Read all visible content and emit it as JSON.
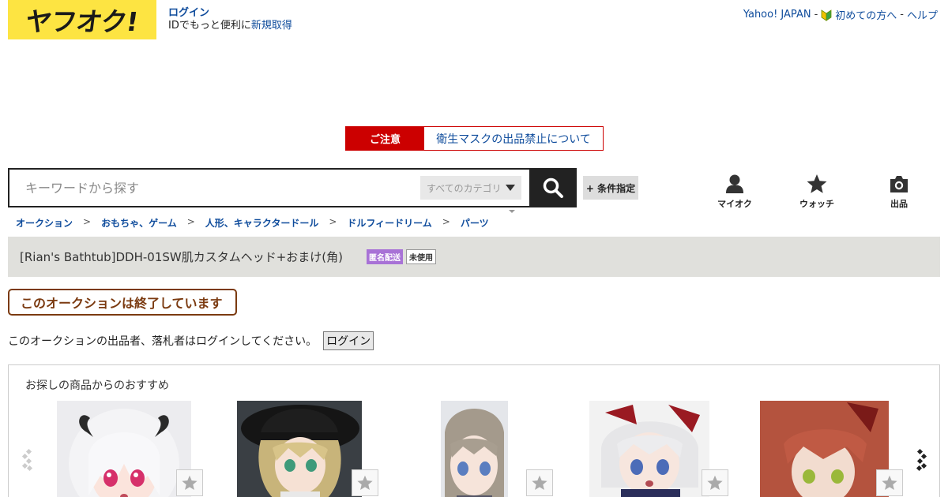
{
  "header": {
    "logo_text": "ヤフオク!",
    "login_label": "ログイン",
    "login_sub_prefix": "IDでもっと便利に",
    "register_label": "新規取得",
    "top_links": [
      "Yahoo! JAPAN",
      "初めての方へ",
      "ヘルプ"
    ],
    "separator": " - "
  },
  "notice": {
    "label": "ご注意",
    "text": "衛生マスクの出品禁止について"
  },
  "search": {
    "placeholder": "キーワードから探す",
    "category": "すべてのカテゴリ",
    "condition_label": "+ 条件指定"
  },
  "nav": [
    {
      "label": "マイオク",
      "icon": "person-icon"
    },
    {
      "label": "ウォッチ",
      "icon": "star-icon"
    },
    {
      "label": "出品",
      "icon": "camera-icon"
    }
  ],
  "breadcrumb": [
    "オークション",
    "おもちゃ、ゲーム",
    "人形、キャラクタードール",
    "ドルフィードリーム",
    "パーツ"
  ],
  "breadcrumb_sep": ">",
  "item": {
    "title": "[Rian's Bathtub]DDH-01SW肌カスタムヘッド+おまけ(角)",
    "badge_shipping": "匿名配送",
    "badge_condition": "未使用"
  },
  "ended_text": "このオークションは終了しています",
  "seller_message": "このオークションの出品者、落札者はログインしてください。",
  "seller_login_button": "ログイン",
  "recommend": {
    "heading": "お探しの商品からのおすすめ"
  },
  "colors": {
    "logo": "#fde442",
    "link": "#0f4c9c",
    "notice_red": "#cc0000",
    "badge_purple": "#a872d6",
    "ended_brown": "#7b3a10"
  }
}
